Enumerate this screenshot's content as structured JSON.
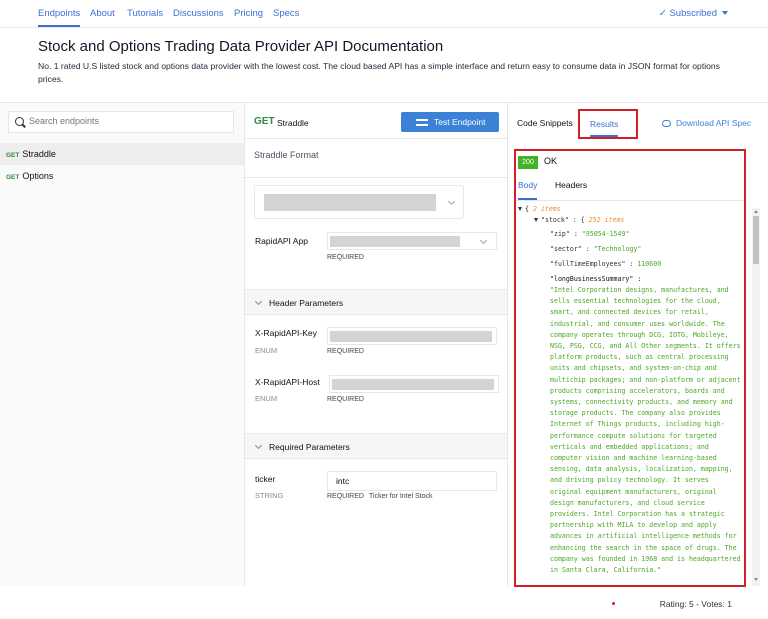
{
  "nav": {
    "tabs": [
      "Endpoints",
      "About",
      "Tutorials",
      "Discussions",
      "Pricing",
      "Specs"
    ],
    "active_tab": "Endpoints",
    "subscribed_label": "Subscribed"
  },
  "page": {
    "title": "Stock and Options Trading Data Provider API Documentation",
    "description": "No. 1 rated U.S listed stock and options data provider with the lowest cost. The cloud based API has a simple interface and return easy to consume data in JSON format for options prices."
  },
  "sidebar": {
    "search_placeholder": "Search endpoints",
    "collapse_glyph": "<",
    "endpoints": [
      {
        "method": "GET",
        "name": "Straddle",
        "selected": true
      },
      {
        "method": "GET",
        "name": "Options",
        "selected": false
      }
    ]
  },
  "endpoint": {
    "method": "GET",
    "name": "Straddle",
    "test_button": "Test Endpoint",
    "format_label": "Straddle Format",
    "rapidapi_app_label": "RapidAPI App",
    "required_label": "REQUIRED",
    "header_params_title": "Header Parameters",
    "headers": [
      {
        "name": "X-RapidAPI-Key",
        "type": "ENUM",
        "required": "REQUIRED"
      },
      {
        "name": "X-RapidAPI-Host",
        "type": "ENUM",
        "required": "REQUIRED"
      }
    ],
    "required_params_title": "Required Parameters",
    "params": [
      {
        "name": "ticker",
        "type": "STRING",
        "value": "intc",
        "required": "REQUIRED",
        "description": "Ticker for Intel Stock"
      }
    ]
  },
  "results_panel": {
    "tabs": [
      "Code Snippets",
      "Results",
      "Download API Spec"
    ],
    "active_tab": "Results",
    "status_code": "200",
    "status_text": "OK",
    "body_tabs": [
      "Body",
      "Headers"
    ],
    "active_body_tab": "Body",
    "json": {
      "root_open": "{",
      "root_count": "2 items",
      "stock_key": "\"stock\" : {",
      "stock_count": "252 items",
      "zip_key": "\"zip\" :",
      "zip_value": "\"95054-1549\"",
      "sector_key": "\"sector\" :",
      "sector_value": "\"Technology\"",
      "employees_key": "\"fullTimeEmployees\" :",
      "employees_value": "110600",
      "summary_key": "\"longBusinessSummary\" :",
      "summary_value": "\"Intel Corporation designs, manufactures, and sells essential technologies for the cloud, smart, and connected devices for retail, industrial, and consumer uses worldwide. The company operates through DCG, IOTG, Mobileye, NSG, PSG, CCG, and All Other segments. It offers platform products, such as central processing units and chipsets, and system-on-chip and multichip packages; and non-platform or adjacent products comprising accelerators, boards and systems, connectivity products, and memory and storage products. The company also provides Internet of Things products, including high-performance compute solutions for targeted verticals and embedded applications; and computer vision and machine learning-based sensing, data analysis, localization, mapping, and driving policy technology. It serves original equipment manufacturers, original design manufacturers, and cloud service providers. Intel Corporation has a strategic partnership with MILA to develop and apply advances in artificial intelligence methods for enhancing the search in the space of drugs. The company was founded in 1968 and is headquartered in Santa Clara, California.\""
    }
  },
  "footer": {
    "rating": "Rating: 5 - Votes: 1"
  },
  "colors": {
    "accent": "#3b6fd6",
    "button": "#3b82d6",
    "get": "#2f8a3d",
    "ok": "#43b224",
    "highlight": "#d31f26",
    "json_string": "#4aa826",
    "json_count": "#f08c35"
  }
}
